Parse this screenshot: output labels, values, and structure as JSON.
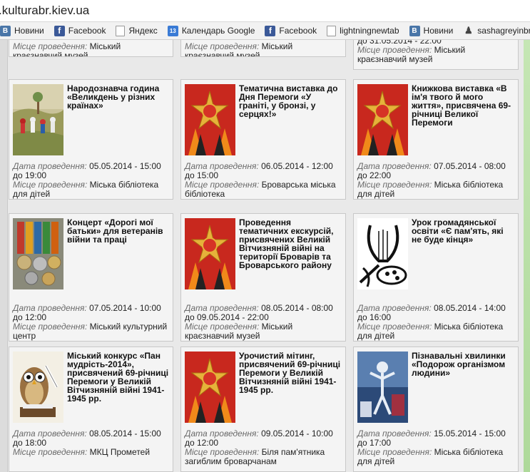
{
  "browser": {
    "address": ".kulturabr.kiev.ua",
    "bookmarks": [
      {
        "label": "Новини",
        "icon": "vk-icon"
      },
      {
        "label": "Facebook",
        "icon": "facebook-icon"
      },
      {
        "label": "Яндекс",
        "icon": "page-icon"
      },
      {
        "label": "Календарь Google",
        "icon": "calendar-icon"
      },
      {
        "label": "Facebook",
        "icon": "facebook-icon"
      },
      {
        "label": "lightningnewtab",
        "icon": "page-icon"
      },
      {
        "label": "Новини",
        "icon": "vk-icon"
      },
      {
        "label": "sashagreyinbro",
        "icon": "user-icon"
      }
    ]
  },
  "labels": {
    "date": "Дата проведення:",
    "place": "Місце проведення:"
  },
  "top_partial": [
    {
      "date_tail": "",
      "place": "Міський краєзнавчий музей"
    },
    {
      "date_tail": "",
      "place": "Міський краєзнавчий музей"
    },
    {
      "date_tail": "до 31.05.2014 - 22:00",
      "place": "Міський краєзнавчий музей"
    }
  ],
  "events": [
    {
      "title": "Народознавча година «Великдень у різних країнах»",
      "date": "05.05.2014 - 15:00 до 19:00",
      "place": "Міська бібліотека для дітей",
      "thumb": "easter-painting"
    },
    {
      "title": "Тематична виставка до Дня Перемоги «У граніті, у бронзі, у серцях!»",
      "date": "06.05.2014 - 12:00 до 15:00",
      "place": "Броварська міська бібліотека",
      "thumb": "victory-order"
    },
    {
      "title": "Книжкова виставка «В ім'я твого й мого життя», присвячена 69-річниці Великої Перемоги",
      "date": "07.05.2014 - 08:00 до 22:00",
      "place": "Міська бібліотека для дітей",
      "thumb": "victory-order"
    },
    {
      "title": "Концерт «Дорогі мої батьки» для ветеранів війни та праці",
      "date": "07.05.2014 - 10:00 до 12:00",
      "place": "Міський культурний центр",
      "thumb": "medals"
    },
    {
      "title": "Проведення тематичних екскурсій, присвячених Великій Вітчизняній війні на території Броварів та Броварського району",
      "date": "08.05.2014 - 08:00 до 09.05.2014 - 22:00",
      "place": "Міський краєзнавчий музей",
      "thumb": "victory-order"
    },
    {
      "title": "Урок громадянської освіти «Є пам'ять, які не буде кінця»",
      "date": "08.05.2014 - 14:00 до 16:00",
      "place": "Міська бібліотека для дітей",
      "thumb": "lyre"
    },
    {
      "title": "Міський конкурс «Пан мудрість-2014», присвячений 69-річниці Перемоги у Великій Вітчизняній війні 1941-1945 рр.",
      "date": "08.05.2014 - 15:00 до 18:00",
      "place": "МКЦ Прометей",
      "thumb": "owl"
    },
    {
      "title": "Урочистий мітинг, присвячений 69-річниці Перемоги у Великій Вітчизняній війні 1941-1945 рр.",
      "date": "09.05.2014 - 10:00 до 12:00",
      "place": "Біля пам'ятника загиблим броварчанам",
      "thumb": "victory-order"
    },
    {
      "title": "Пізнавальні хвилинки «Подорож організмом людини»",
      "date": "15.05.2014 - 15:00 до 17:00",
      "place": "Міська бібліотека для дітей",
      "thumb": "human-body"
    }
  ],
  "colors": {
    "card_bg": "#f4f4f4",
    "card_border": "#c8c8c8",
    "label_gray": "#6a6a6a",
    "sidebar_green": "#b5dca2"
  }
}
